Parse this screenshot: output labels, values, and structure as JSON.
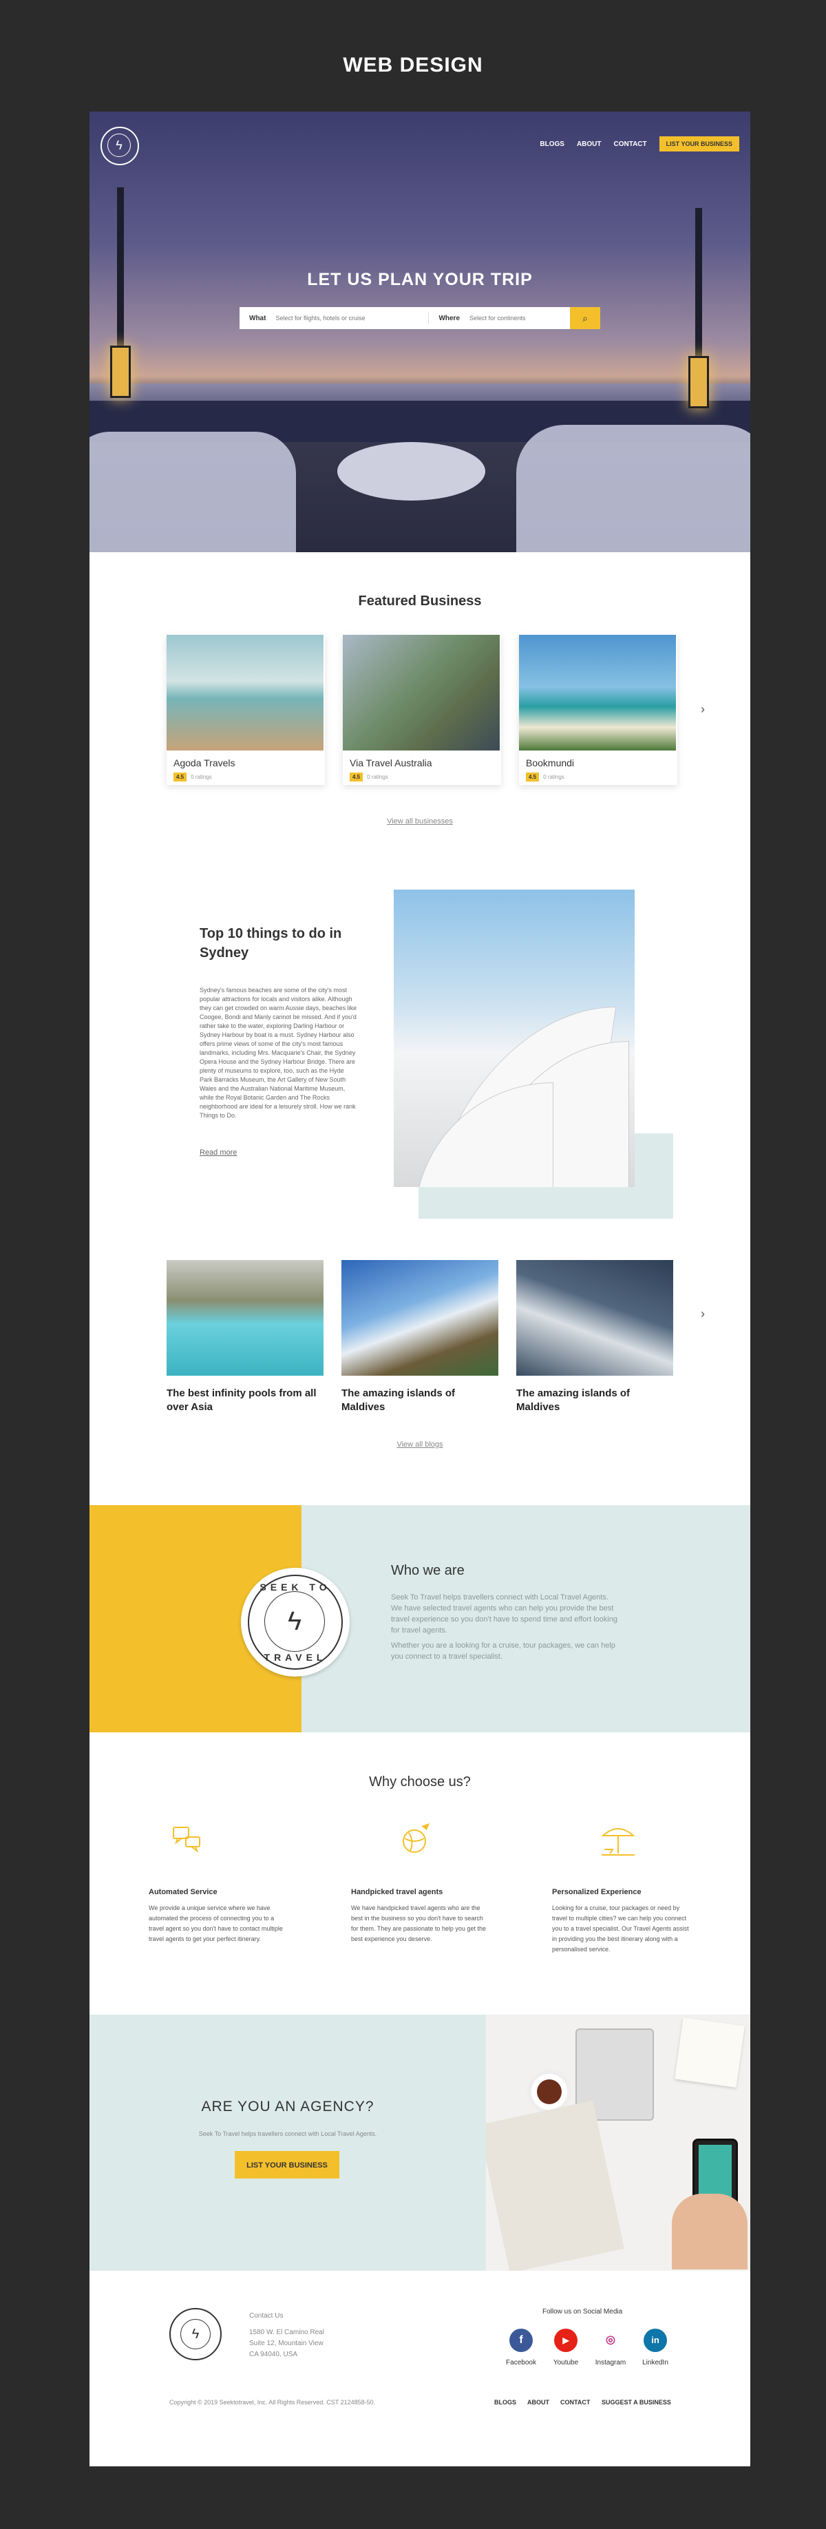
{
  "page_header": "WEB DESIGN",
  "nav": {
    "logo": "Seek To Travel",
    "items": [
      "BLOGS",
      "ABOUT",
      "CONTACT"
    ],
    "cta": "LIST YOUR BUSINESS"
  },
  "hero": {
    "title": "LET US PLAN YOUR TRIP",
    "what_label": "What",
    "what_placeholder": "Select for flights, hotels or cruise",
    "where_label": "Where",
    "where_placeholder": "Select for continents",
    "search_icon": "search-icon"
  },
  "featured": {
    "title": "Featured Business",
    "cards": [
      {
        "name": "Agoda Travels",
        "rating": "4.5",
        "ratings": "0 ratings"
      },
      {
        "name": "Via Travel Australia",
        "rating": "4.5",
        "ratings": "0 ratings"
      },
      {
        "name": "Bookmundi",
        "rating": "4.5",
        "ratings": "0 ratings"
      }
    ],
    "view_all": "View all businesses"
  },
  "article": {
    "title": "Top 10 things to do in Sydney",
    "body": "Sydney's famous beaches are some of the city's most popular attractions for locals and visitors alike. Although they can get crowded on warm Aussie days, beaches like Coogee, Bondi and Manly cannot be missed. And if you'd rather take to the water, exploring Darling Harbour or Sydney Harbour by boat is a must. Sydney Harbour also offers prime views of some of the city's most famous landmarks, including Mrs. Macquarie's Chair, the Sydney Opera House and the Sydney Harbour Bridge. There are plenty of museums to explore, too, such as the Hyde Park Barracks Museum, the Art Gallery of New South Wales and the Australian National Maritime Museum, while the Royal Botanic Garden and The Rocks neighborhood are ideal for a leisurely stroll. How we rank Things to Do.",
    "read_more": "Read more"
  },
  "blogs": {
    "items": [
      "The best infinity pools from all over Asia",
      "The amazing islands of Maldives",
      "The amazing islands of Maldives"
    ],
    "view_all": "View all blogs"
  },
  "who": {
    "seal_top": "SEEK TO",
    "seal_bottom": "TRAVEL",
    "title": "Who we are",
    "p1": "Seek To Travel helps travellers connect with Local Travel Agents. We have selected travel agents who can help you provide the best travel experience so you don't have to spend time and effort looking for travel agents.",
    "p2": "Whether you are a looking for a cruise, tour packages, we can help you connect to a travel specialist."
  },
  "why": {
    "title": "Why choose us?",
    "items": [
      {
        "heading": "Automated Service",
        "text": "We provide a unique service where we have automated the process of connecting you to a travel agent so you don't have to contact multiple travel agents to get your perfect itinerary.",
        "icon": "chat-bubbles-icon"
      },
      {
        "heading": "Handpicked travel agents",
        "text": "We have handpicked travel agents who are the best in the business so you don't have to search for them. They are passionate to help you get the best experience you deserve.",
        "icon": "globe-plane-icon"
      },
      {
        "heading": "Personalized Experience",
        "text": "Looking for a cruise, tour packages or need by travel to multiple cities? we can help you connect you to a travel specialist. Our Travel Agents assist in providing you the best itinerary along with a personalised service.",
        "icon": "beach-umbrella-icon"
      }
    ]
  },
  "agency": {
    "title": "ARE YOU AN AGENCY?",
    "subtitle": "Seek To Travel helps travellers connect with Local Travel Agents.",
    "button": "LIST YOUR BUSINESS"
  },
  "footer": {
    "contact_title": "Contact Us",
    "address1": "1580 W. El Camino Real",
    "address2": "Suite 12, Mountain View",
    "address3": "CA 94040, USA",
    "social_title": "Follow us on Social Media",
    "social": [
      {
        "name": "Facebook",
        "glyph": "f",
        "color": "#3b5998"
      },
      {
        "name": "Youtube",
        "glyph": "▶",
        "color": "#e62117"
      },
      {
        "name": "Instagram",
        "glyph": "◎",
        "color": "#c13584"
      },
      {
        "name": "LinkedIn",
        "glyph": "in",
        "color": "#0e76a8"
      }
    ],
    "copyright": "Copyright © 2019 Seektotravel, Inc. All Rights Reserved. CST 2124858-50.",
    "links": [
      "BLOGS",
      "ABOUT",
      "CONTACT",
      "SUGGEST A BUSINESS"
    ]
  },
  "colors": {
    "accent": "#f3c02c",
    "mint": "#dcebe9",
    "dark": "#2b2b2b"
  }
}
